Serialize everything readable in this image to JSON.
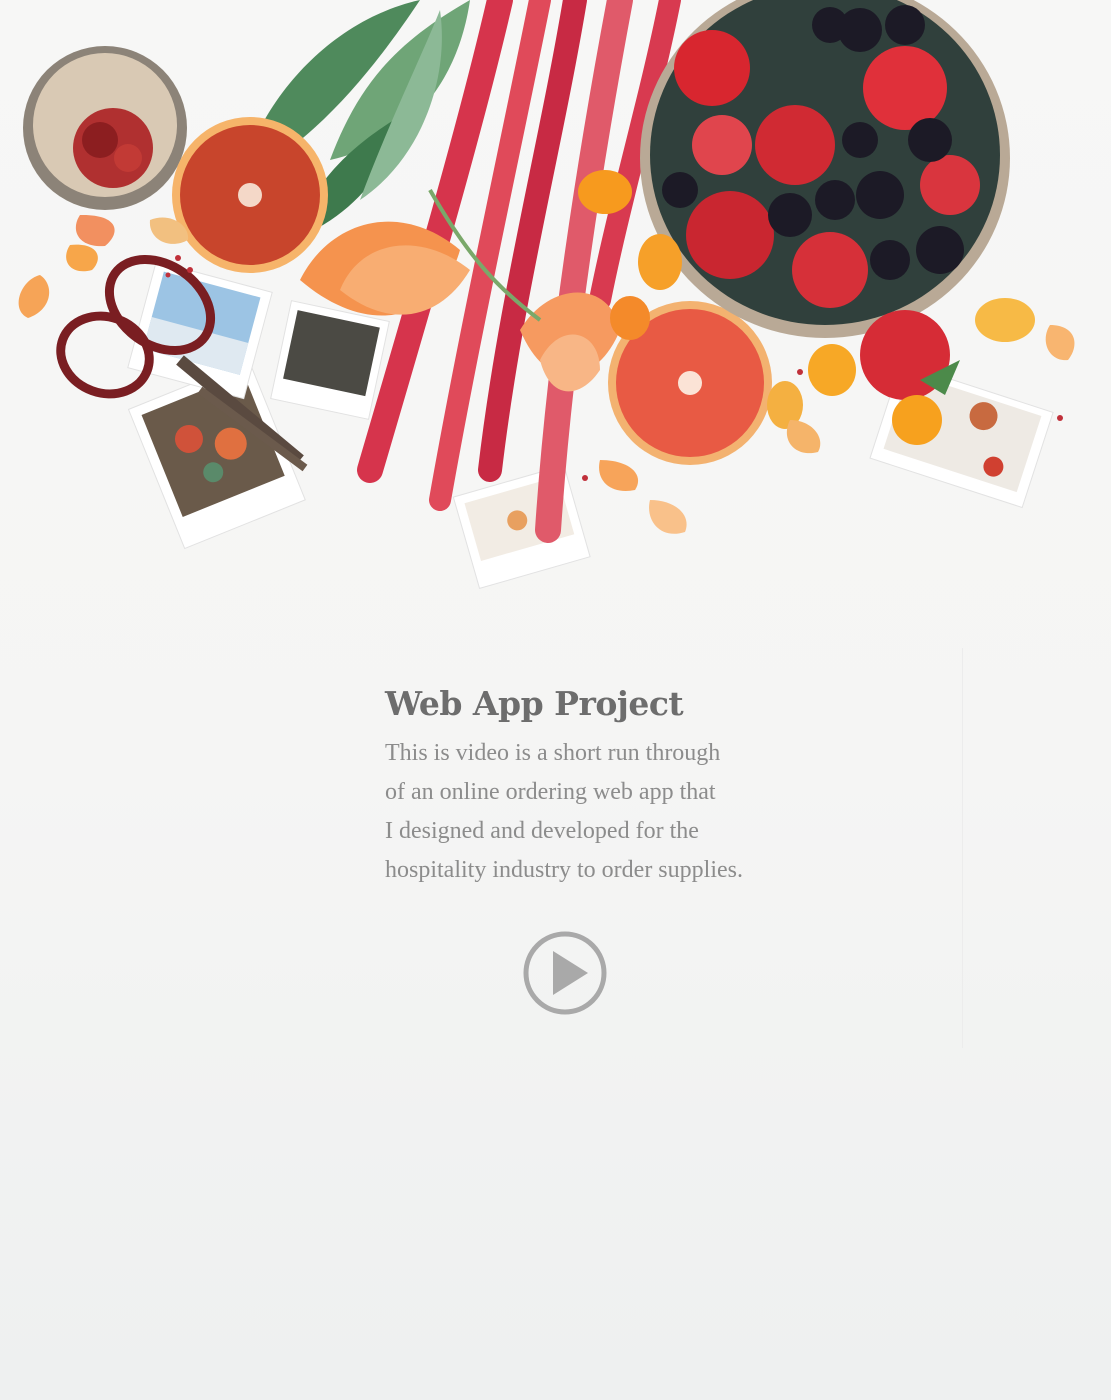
{
  "project": {
    "title": "Web App Project",
    "description_lines": [
      "This is video is a short run through",
      "of an online ordering web app that",
      "I designed and developed for the",
      "hospitality industry to order supplies."
    ]
  },
  "video": {
    "play_icon": "play-circle-icon"
  },
  "colors": {
    "title": "#6d6d6d",
    "body_text": "#8c8c8c",
    "play_icon": "#a9a9a9",
    "background": "#f6f6f5"
  }
}
